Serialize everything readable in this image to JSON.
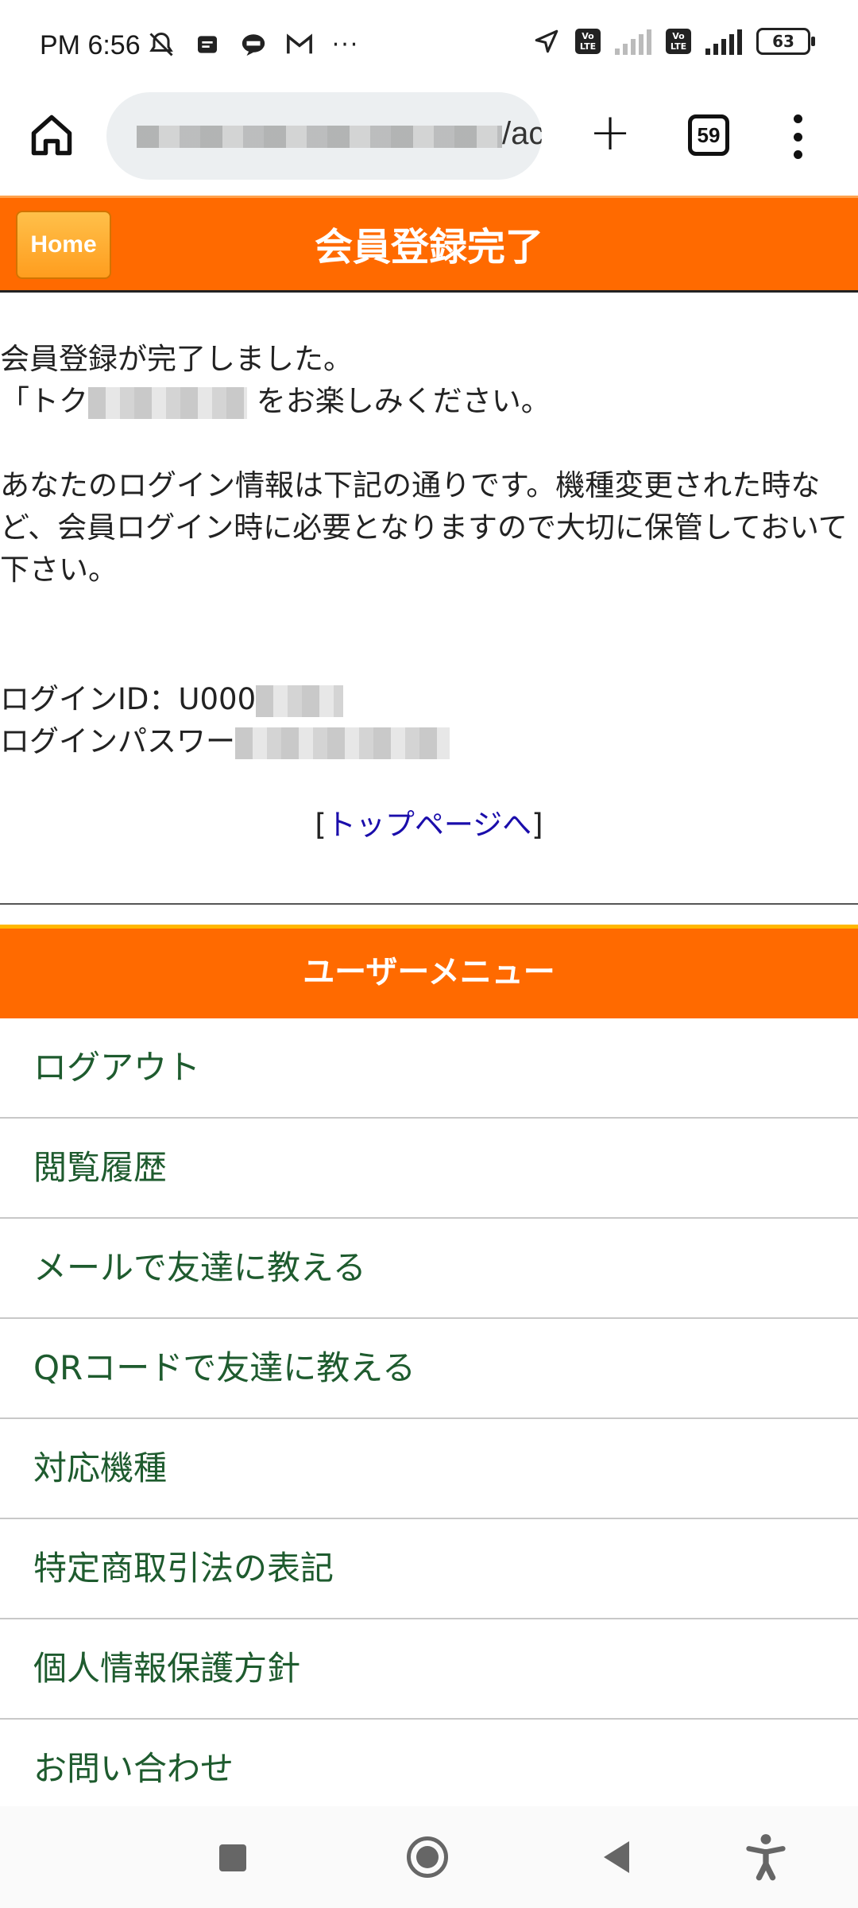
{
  "status_bar": {
    "time": "PM 6:56",
    "more_notifications": "···",
    "battery_level": "63"
  },
  "browser": {
    "url_visible_suffix": "/account",
    "tab_count": "59"
  },
  "page": {
    "home_button_label": "Home",
    "title": "会員登録完了"
  },
  "content": {
    "line1": "会員登録が完了しました。",
    "line2_prefix": "「トク",
    "line2_suffix": "をお楽しみください。",
    "info_text": "あなたのログイン情報は下記の通りです。機種変更された時など、会員ログイン時に必要となりますので大切に保管しておいて下さい。",
    "login_id_label": "ログインID：U000",
    "login_password_label": "ログインパスワー",
    "bracket_open": "[",
    "top_link": "トップページへ",
    "bracket_close": "]"
  },
  "user_menu": {
    "title": "ユーザーメニュー",
    "items": [
      "ログアウト",
      "閲覧履歴",
      "メールで友達に教える",
      "QRコードで友達に教える",
      "対応機種",
      "特定商取引法の表記",
      "個人情報保護方針",
      "お問い合わせ"
    ]
  }
}
